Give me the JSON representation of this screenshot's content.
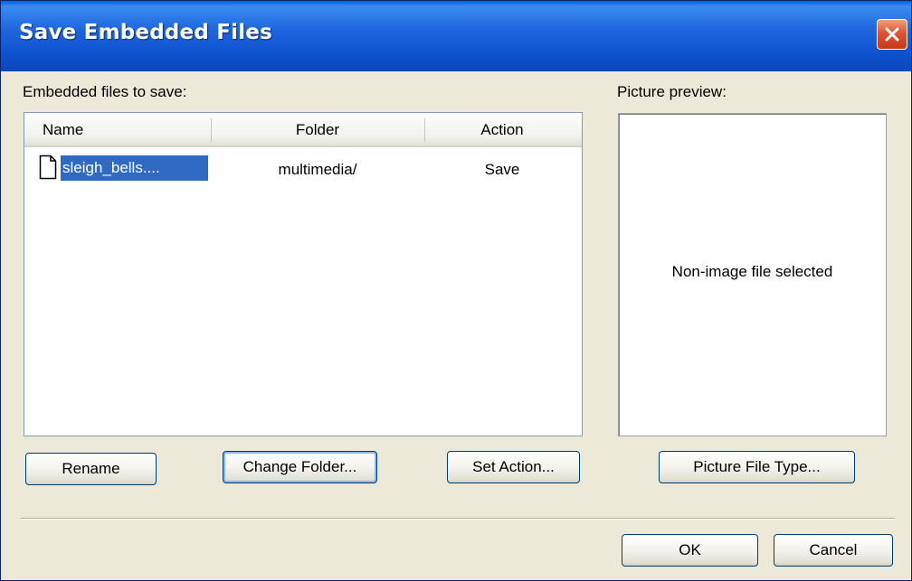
{
  "window": {
    "title": "Save Embedded Files"
  },
  "files_section": {
    "label": "Embedded files to save:",
    "columns": [
      "Name",
      "Folder",
      "Action"
    ],
    "rows": [
      {
        "name": "sleigh_bells....",
        "folder": "multimedia/",
        "action": "Save",
        "icon": "document-icon",
        "selected": true
      }
    ]
  },
  "preview_section": {
    "label": "Picture preview:",
    "message": "Non-image file selected"
  },
  "buttons": {
    "rename": "Rename",
    "change_folder": "Change Folder...",
    "set_action": "Set Action...",
    "picture_file_type": "Picture File Type...",
    "ok": "OK",
    "cancel": "Cancel"
  },
  "colors": {
    "titlebar": "#0f52cf",
    "selection": "#316ac5",
    "close": "#e0532f",
    "dialog_bg": "#ece9d8"
  }
}
